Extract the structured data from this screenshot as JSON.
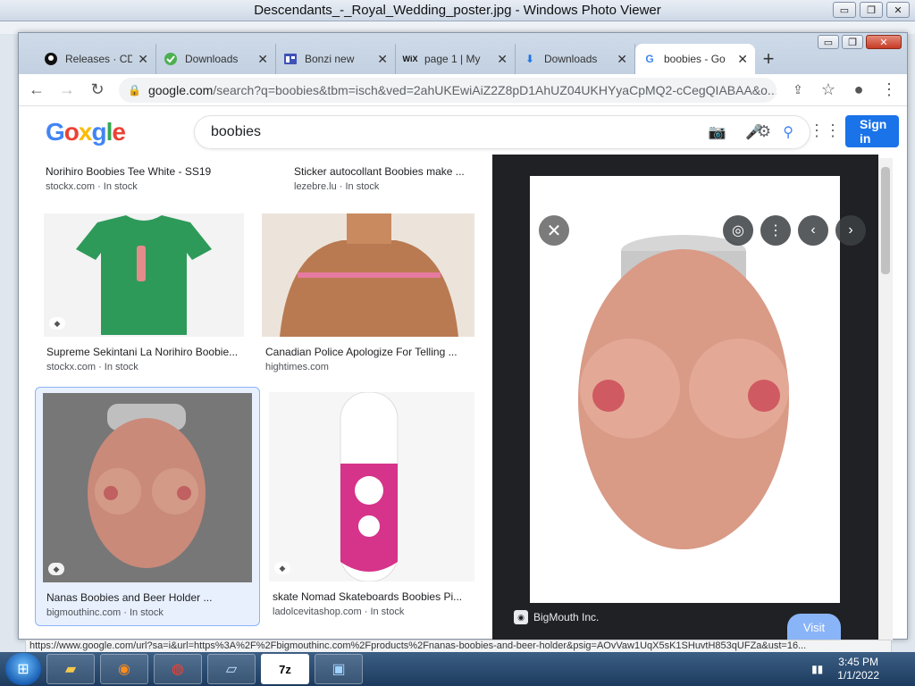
{
  "photo_viewer": {
    "title": "Descendants_-_Royal_Wedding_poster.jpg - Windows Photo Viewer",
    "buttons": {
      "minimize": "▭",
      "maximize": "❐",
      "close": "✕"
    }
  },
  "browser": {
    "tabs": [
      {
        "label": "Releases · CD",
        "icon": "github-icon"
      },
      {
        "label": "Downloads",
        "icon": "downloads-site-icon"
      },
      {
        "label": "Bonzi new",
        "icon": "page-icon"
      },
      {
        "label": "page 1 | My",
        "icon": "wix-icon"
      },
      {
        "label": "Downloads",
        "icon": "download-icon"
      },
      {
        "label": "boobies - Go",
        "icon": "google-icon",
        "active": true
      }
    ],
    "new_tab": "+",
    "url_domain": "google.com",
    "url_rest": "/search?q=boobies&tbm=isch&ved=2ahUKEwiAiZ2Z8pD1AhUZ04UKHYyaCpMQ2-cCegQIABAA&o...",
    "status_url": "https://www.google.com/url?sa=i&url=https%3A%2F%2Fbigmouthinc.com%2Fproducts%2Fnanas-boobies-and-beer-holder&psig=AOvVaw1UqX5sK1SHuvtH853qUFZa&ust=16..."
  },
  "google": {
    "query": "boobies",
    "signin": "Sign in",
    "results": [
      {
        "title": "Norihiro Boobies Tee White - SS19",
        "source": "stockx.com",
        "stock": "In stock"
      },
      {
        "title": "Sticker autocollant Boobies make ...",
        "source": "lezebre.lu",
        "stock": "In stock"
      },
      {
        "title": "Supreme Sekintani La Norihiro Boobie...",
        "source": "stockx.com",
        "stock": "In stock"
      },
      {
        "title": "Canadian Police Apologize For Telling ...",
        "source": "hightimes.com",
        "stock": ""
      },
      {
        "title": "Nanas Boobies and Beer Holder ...",
        "source": "bigmouthinc.com",
        "stock": "In stock"
      },
      {
        "title": "skate Nomad Skateboards Boobies Pi...",
        "source": "ladolcevitashop.com",
        "stock": "In stock"
      }
    ],
    "preview": {
      "site": "BigMouth Inc.",
      "visit": "Visit"
    }
  },
  "taskbar": {
    "time": "3:45 PM",
    "date": "1/1/2022",
    "seven_zip": "7z"
  },
  "colors": {
    "google_blue": "#1a73e8",
    "preview_bg": "#202124"
  }
}
